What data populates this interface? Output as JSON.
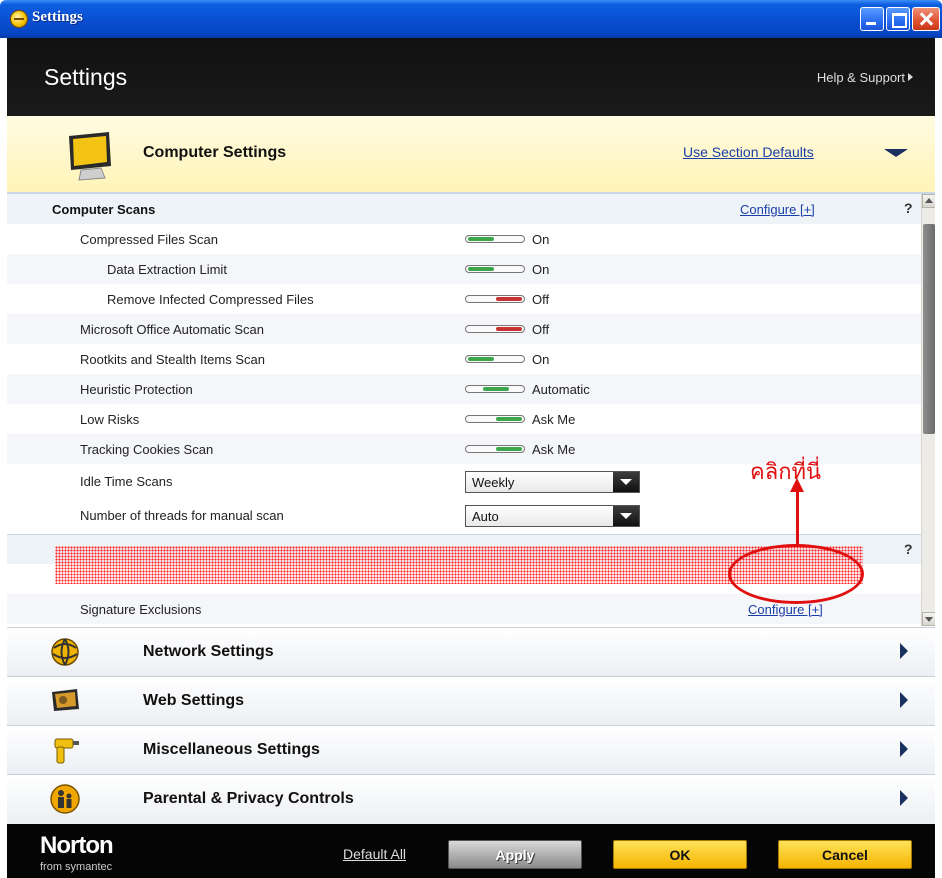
{
  "window": {
    "title": "Settings"
  },
  "header": {
    "title": "Settings",
    "help_link": "Help & Support"
  },
  "computer_settings": {
    "title": "Computer Settings",
    "defaults_link": "Use Section Defaults",
    "icon": "monitor-icon"
  },
  "sections": {
    "computer_scans": {
      "name": "Computer Scans",
      "configure": "Configure [+]",
      "help": "?",
      "rows": [
        {
          "label": "Compressed Files Scan",
          "value": "On",
          "state": "on"
        },
        {
          "label": "Data Extraction Limit",
          "value": "On",
          "state": "on"
        },
        {
          "label": "Remove Infected Compressed Files",
          "value": "Off",
          "state": "off"
        },
        {
          "label": "Microsoft Office Automatic Scan",
          "value": "Off",
          "state": "off"
        },
        {
          "label": "Rootkits and Stealth Items Scan",
          "value": "On",
          "state": "on"
        },
        {
          "label": "Heuristic Protection",
          "value": "Automatic",
          "state": "auto"
        },
        {
          "label": "Low Risks",
          "value": "Ask Me",
          "state": "ask"
        },
        {
          "label": "Tracking Cookies Scan",
          "value": "Ask Me",
          "state": "ask"
        },
        {
          "label": "Idle Time Scans",
          "value": "Weekly",
          "control": "dropdown"
        },
        {
          "label": "Number of threads for manual scan",
          "value": "Auto",
          "control": "dropdown"
        }
      ]
    },
    "exclusions": {
      "help": "?",
      "signature_label": "Signature Exclusions",
      "signature_configure": "Configure [+]"
    }
  },
  "annotation": {
    "text": "คลิกที่นี่",
    "color": "#e01010"
  },
  "categories": [
    {
      "name": "Network Settings",
      "icon": "globe-network-icon"
    },
    {
      "name": "Web Settings",
      "icon": "web-map-icon"
    },
    {
      "name": "Miscellaneous Settings",
      "icon": "drill-icon"
    },
    {
      "name": "Parental & Privacy Controls",
      "icon": "family-icon"
    }
  ],
  "footer": {
    "brand": "Norton",
    "brand_sub": "from symantec",
    "default_all": "Default All",
    "apply": "Apply",
    "ok": "OK",
    "cancel": "Cancel"
  },
  "colors": {
    "accent_yellow": "#f5b400",
    "link_blue": "#1a3ea8",
    "on_green": "#3ca64a",
    "off_red": "#c83232"
  }
}
